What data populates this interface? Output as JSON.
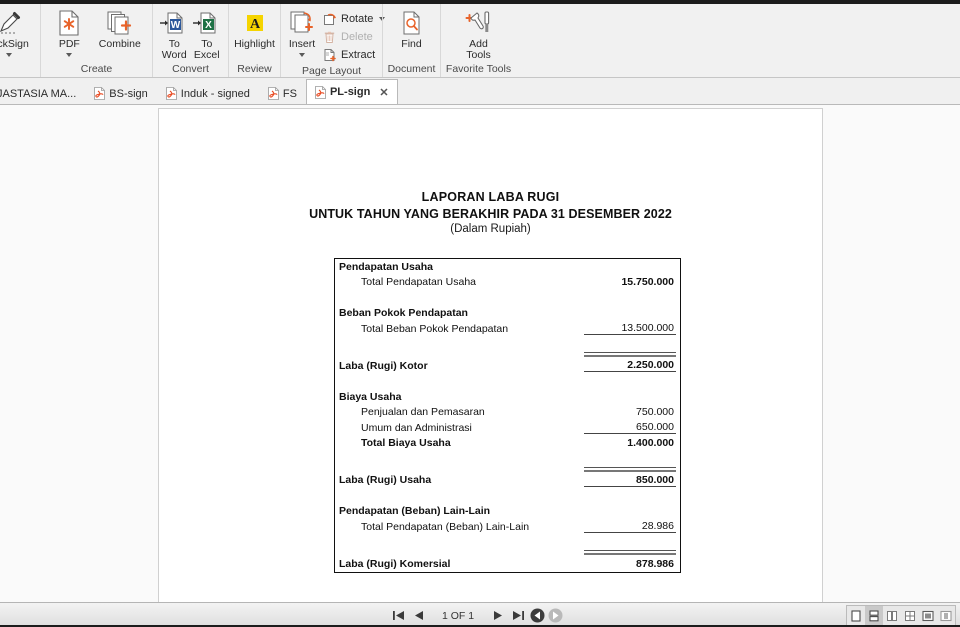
{
  "ribbon": {
    "groups": [
      {
        "label": "",
        "buttons": [
          {
            "name": "quicksign",
            "label": "uickSign",
            "icon": "pen-icon",
            "has_caret": true
          }
        ]
      },
      {
        "label": "Create",
        "buttons": [
          {
            "name": "pdf",
            "label": "PDF",
            "icon": "pdf-new-icon",
            "has_caret": true
          },
          {
            "name": "combine",
            "label": "Combine",
            "icon": "combine-icon",
            "has_caret": false
          }
        ]
      },
      {
        "label": "Convert",
        "buttons": [
          {
            "name": "to-word",
            "label": "To\nWord",
            "icon": "to-word-icon",
            "has_caret": false
          },
          {
            "name": "to-excel",
            "label": "To\nExcel",
            "icon": "to-excel-icon",
            "has_caret": false
          }
        ]
      },
      {
        "label": "Review",
        "buttons": [
          {
            "name": "highlight",
            "label": "Highlight",
            "icon": "highlight-icon",
            "has_caret": false
          }
        ]
      },
      {
        "label": "Page Layout",
        "buttons": [
          {
            "name": "insert",
            "label": "Insert",
            "icon": "insert-page-icon",
            "has_caret": true
          }
        ],
        "small_buttons": [
          {
            "name": "rotate",
            "label": "Rotate",
            "icon": "rotate-icon",
            "disabled": false,
            "has_caret": true
          },
          {
            "name": "delete",
            "label": "Delete",
            "icon": "trash-icon",
            "disabled": true,
            "has_caret": false
          },
          {
            "name": "extract",
            "label": "Extract",
            "icon": "extract-icon",
            "disabled": false,
            "has_caret": false
          }
        ]
      },
      {
        "label": "Document",
        "buttons": [
          {
            "name": "find",
            "label": "Find",
            "icon": "find-icon",
            "has_caret": false
          }
        ]
      },
      {
        "label": "Favorite Tools",
        "buttons": [
          {
            "name": "add-tools",
            "label": "Add\nTools",
            "icon": "add-tools-icon",
            "has_caret": false
          }
        ]
      }
    ]
  },
  "tabs": [
    {
      "label": "JASTASIA MA...",
      "active": false,
      "show_icon": false,
      "closable": false
    },
    {
      "label": "BS-sign",
      "active": false,
      "show_icon": true,
      "closable": false
    },
    {
      "label": "Induk - signed",
      "active": false,
      "show_icon": true,
      "closable": false
    },
    {
      "label": "FS",
      "active": false,
      "show_icon": true,
      "closable": false
    },
    {
      "label": "PL-sign",
      "active": true,
      "show_icon": true,
      "closable": true
    }
  ],
  "document": {
    "title_line1": "LAPORAN LABA RUGI",
    "title_line2": "UNTUK TAHUN YANG BERAKHIR PADA 31 DESEMBER 2022",
    "title_line3": "(Dalam Rupiah)",
    "statement": [
      {
        "label": "Pendapatan Usaha",
        "amount": "",
        "style": "head"
      },
      {
        "label": "Total Pendapatan Usaha",
        "amount": "15.750.000",
        "style": "ind",
        "bold_amount": true
      },
      {
        "label": "",
        "amount": "",
        "style": "spacer"
      },
      {
        "label": "Beban Pokok Pendapatan",
        "amount": "",
        "style": "head"
      },
      {
        "label": "Total Beban Pokok Pendapatan",
        "amount": "13.500.000",
        "style": "ind",
        "underline": "single"
      },
      {
        "label": "",
        "amount": "",
        "style": "spacer"
      },
      {
        "label": "",
        "amount": "",
        "style": "doublerule"
      },
      {
        "label": "Laba (Rugi) Kotor",
        "amount": "2.250.000",
        "style": "tot",
        "bold_amount": true,
        "underline": "single"
      },
      {
        "label": "",
        "amount": "",
        "style": "spacer"
      },
      {
        "label": "Biaya Usaha",
        "amount": "",
        "style": "head"
      },
      {
        "label": "Penjualan dan Pemasaran",
        "amount": "750.000",
        "style": "ind"
      },
      {
        "label": "Umum dan Administrasi",
        "amount": "650.000",
        "style": "ind",
        "underline": "single"
      },
      {
        "label": "Total Biaya Usaha",
        "amount": "1.400.000",
        "style": "ind2",
        "bold_amount": true
      },
      {
        "label": "",
        "amount": "",
        "style": "spacer"
      },
      {
        "label": "",
        "amount": "",
        "style": "doublerule"
      },
      {
        "label": "Laba (Rugi) Usaha",
        "amount": "850.000",
        "style": "tot",
        "bold_amount": true,
        "underline": "single"
      },
      {
        "label": "",
        "amount": "",
        "style": "spacer"
      },
      {
        "label": "Pendapatan (Beban) Lain-Lain",
        "amount": "",
        "style": "head"
      },
      {
        "label": "Total Pendapatan (Beban) Lain-Lain",
        "amount": "28.986",
        "style": "ind",
        "underline": "single"
      },
      {
        "label": "",
        "amount": "",
        "style": "spacer"
      },
      {
        "label": "",
        "amount": "",
        "style": "doublerule"
      },
      {
        "label": "Laba (Rugi) Komersial",
        "amount": "878.986",
        "style": "tot",
        "bold_amount": true
      }
    ]
  },
  "bottom_bar": {
    "page_indicator": "1 OF 1",
    "nav_buttons": [
      {
        "name": "first-page-button",
        "icon": "first-page-icon"
      },
      {
        "name": "previous-page-button",
        "icon": "prev-page-icon"
      },
      {
        "name": "next-page-button",
        "icon": "next-page-icon"
      },
      {
        "name": "last-page-button",
        "icon": "last-page-icon"
      },
      {
        "name": "previous-view-button",
        "icon": "back-view-icon"
      },
      {
        "name": "next-view-button",
        "icon": "forward-view-icon"
      }
    ],
    "view_modes": [
      {
        "name": "single-page-view",
        "icon": "single-page-icon",
        "selected": false
      },
      {
        "name": "continuous-view",
        "icon": "continuous-page-icon",
        "selected": true
      },
      {
        "name": "two-page-view",
        "icon": "two-page-icon",
        "selected": false
      },
      {
        "name": "grid-view",
        "icon": "four-page-icon",
        "selected": false
      },
      {
        "name": "fit-page-view",
        "icon": "fit-page-icon",
        "selected": false
      },
      {
        "name": "fit-width-view",
        "icon": "fit-width-icon",
        "selected": false
      }
    ]
  },
  "colors": {
    "accent": "#e8632a",
    "ribbon_bg": "#f1f1f1",
    "workspace_bg": "#fafafa",
    "highlight_yellow": "#f5d400",
    "word_blue": "#2b579a",
    "excel_green": "#1e7145"
  }
}
